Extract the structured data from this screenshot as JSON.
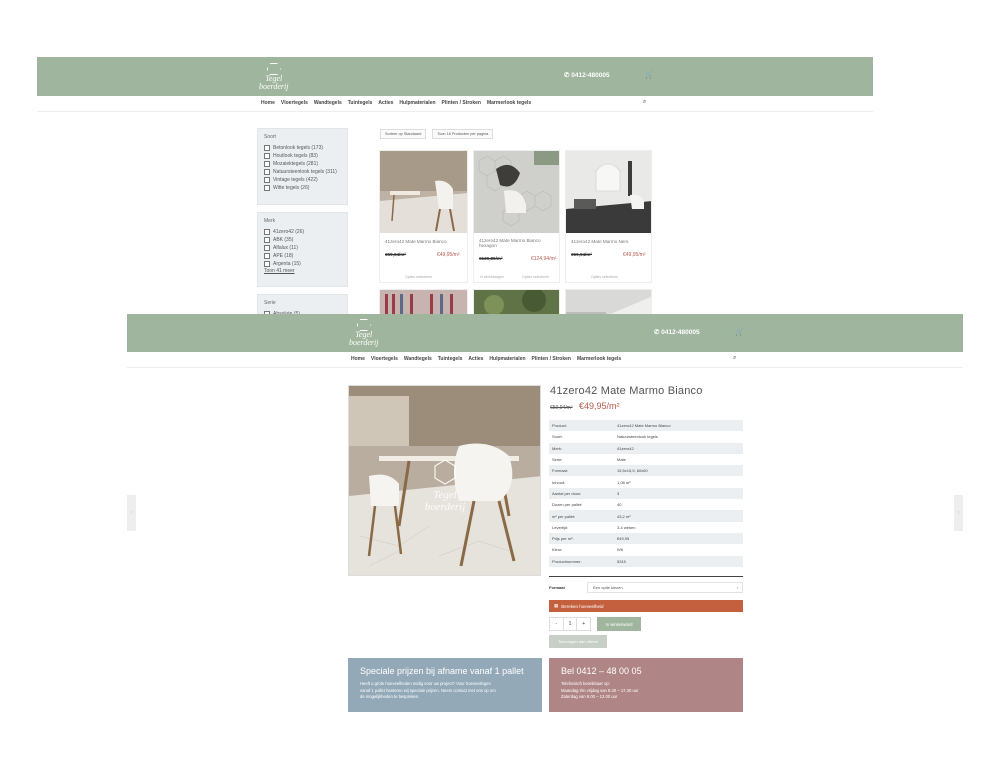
{
  "site": {
    "logo_line1": "Tegel",
    "logo_line2": "boerderij",
    "logo_badge": "NL",
    "phone": "0412-480005",
    "cart_icon": "cart-icon",
    "nav": [
      "Home",
      "Vloertegels",
      "Wandtegels",
      "Tuintegels",
      "Acties",
      "Hulpmaterialen",
      "Plinten / Stroken",
      "Marmerlook tegels"
    ],
    "search_icon": "search-icon",
    "brand_color": "#9fb59d"
  },
  "listing": {
    "filters": [
      {
        "title": "Soort",
        "items": [
          "Betonlook tegels (173)",
          "Houtlook tegels (83)",
          "Mozaiektegels (281)",
          "Natuursteenlook tegels (311)",
          "Vintage tegels (422)",
          "Witte tegels (26)"
        ]
      },
      {
        "title": "Merk",
        "items": [
          "41zero42 (26)",
          "ABK (35)",
          "Alfalux (11)",
          "APE (18)",
          "Argenta (15)"
        ],
        "more": "Toon 41 meer"
      },
      {
        "title": "Serie",
        "items": [
          "Absolute (5)"
        ]
      }
    ],
    "sort_label": "Sorteer op Standaard",
    "perpage_label": "Toon 16 Producten per pagina",
    "products": [
      {
        "name": "41zero42 Mate Marmo Bianco",
        "old": "€59,94/m²",
        "new": "€49,95/m²",
        "act1": "Opties selecteren",
        "act2": ""
      },
      {
        "name": "41zero42 Mate Marmo Bianco hexagon",
        "old": "€139,89/m²",
        "new": "€124,94/m²",
        "act1": "In winkelwagen",
        "act2": "Opties selecteren"
      },
      {
        "name": "41zero42 Mate Marmo Nero",
        "old": "€59,94/m²",
        "new": "€49,95/m²",
        "act1": "Opties selecteren",
        "act2": ""
      }
    ]
  },
  "product": {
    "title": "41zero42 Mate Marmo Bianco",
    "old_price": "€59,94/m²",
    "price": "€49,95/m²",
    "specs": [
      [
        "Product:",
        "41zero42 Mate Marmo Bianco"
      ],
      [
        "Soort:",
        "Natuursteenlook tegels"
      ],
      [
        "Merk:",
        "41zero42"
      ],
      [
        "Serie:",
        "Mate"
      ],
      [
        "Formaat:",
        "15,5x15,5, 60x60"
      ],
      [
        "Inhoud:",
        "1,08 m²"
      ],
      [
        "Aantal per doos:",
        "3"
      ],
      [
        "Dozen per pallet:",
        "40"
      ],
      [
        "m² per pallet:",
        "43,2 m²"
      ],
      [
        "Levertijd:",
        "3-4 weken"
      ],
      [
        "Prijs per m²:",
        "€49,95"
      ],
      [
        "Kleur:",
        "Wit"
      ],
      [
        "Productnummer:",
        "5315"
      ]
    ],
    "format_label": "Formaat",
    "format_placeholder": "Een optie kiezen",
    "calc_button": "Bereken hoeveelheid",
    "qty_minus": "-",
    "qty": "1",
    "qty_plus": "+",
    "cart_button": "In winkelwand",
    "offer_button": "Toevoegen aan offerte",
    "promo1_title": "Speciale prijzen bij afname vanaf 1 pallet",
    "promo1_lines": [
      "Heeft u grote hoeveelheden nodig voor uw project? Voor hoeveelingen",
      "vanaf 1 pallet hanteren wij speciale prijzen. Neem contact met ons op om",
      "de mogelijkheden te bespreken."
    ],
    "promo2_title": "Bel 0412 – 48 00 05",
    "promo2_lines": [
      "Telefonisch bereikbaar op:",
      "Maandag t/m vrijdag van 8.30 – 17.30 uur",
      "Zaterdag van 9.00 – 12.00 uur"
    ],
    "promo1_color": "#93a9b8",
    "promo2_color": "#b08586",
    "accent": "#c4603d"
  }
}
